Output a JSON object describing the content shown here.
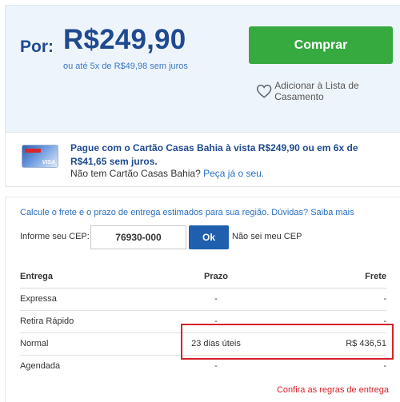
{
  "price": {
    "prefix": "Por:",
    "value": "R$249,90",
    "installments": "ou até 5x de R$49,98 sem juros"
  },
  "actions": {
    "buy_label": "Comprar",
    "wishlist_label": "Adicionar à Lista de Casamento",
    "wishlist_icon": "heart-icon"
  },
  "card_promo": {
    "card_brand": "Casas Bahia",
    "card_network": "VISA",
    "headline": "Pague com o Cartão Casas Bahia à vista R$249,90 ou em 6x de R$41,65 sem juros.",
    "question": "Não tem Cartão Casas Bahia?",
    "link": "Peça já o seu."
  },
  "shipping": {
    "intro": "Calcule o frete e o prazo de entrega estimados para sua região. Dúvidas? Saiba mais",
    "cep_label": "Informe seu CEP:",
    "cep_value": "76930-000",
    "ok_label": "Ok",
    "dont_know": "Não sei meu CEP",
    "columns": [
      "Entrega",
      "Prazo",
      "Frete"
    ],
    "rows": [
      {
        "type": "Expressa",
        "prazo": "-",
        "frete": "-"
      },
      {
        "type": "Retira Rápido",
        "prazo": "-",
        "frete": "-"
      },
      {
        "type": "Normal",
        "prazo": "23 dias úteis",
        "frete": "R$ 436,51"
      },
      {
        "type": "Agendada",
        "prazo": "-",
        "frete": "-"
      }
    ],
    "rules_link": "Confira as regras de entrega"
  },
  "colors": {
    "price_blue": "#1f4a8f",
    "buy_green": "#36a93f",
    "highlight_red": "#d4212a",
    "link_blue": "#2a6fc0"
  }
}
